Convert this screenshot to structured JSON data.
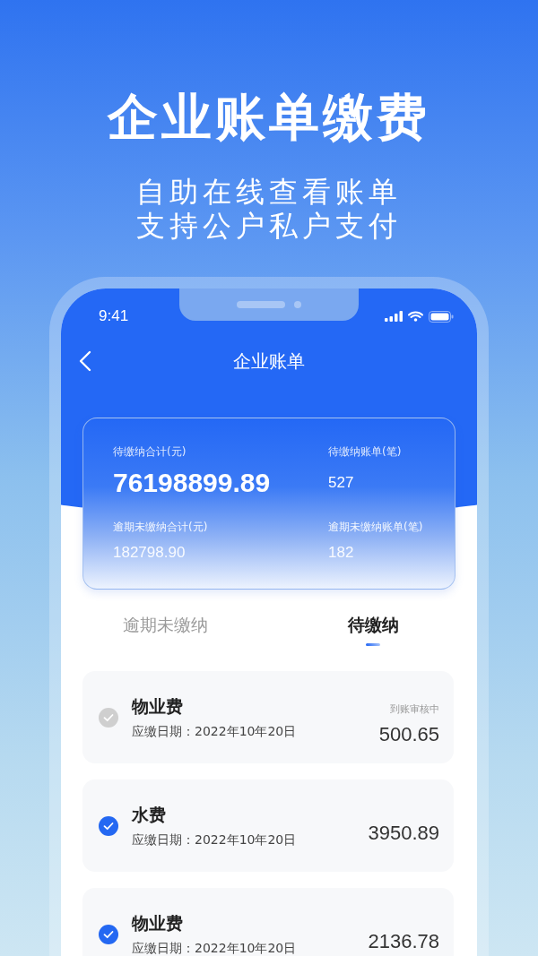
{
  "headline": "企业账单缴费",
  "subtitle_lines": [
    "自助在线查看账单",
    "支持公户私户支付"
  ],
  "status_bar": {
    "time": "9:41"
  },
  "nav": {
    "title": "企业账单"
  },
  "summary": [
    {
      "label": "待缴纳合计(元)",
      "value": "76198899.89",
      "kind": "primary"
    },
    {
      "label": "待缴纳账单(笔)",
      "value": "527",
      "kind": "normal"
    },
    {
      "label": "逾期未缴纳合计(元)",
      "value": "182798.90",
      "kind": "muted"
    },
    {
      "label": "逾期未缴纳账单(笔)",
      "value": "182",
      "kind": "muted"
    }
  ],
  "tabs": [
    {
      "label": "逾期未缴纳",
      "selected": false
    },
    {
      "label": "待缴纳",
      "selected": true
    }
  ],
  "bills": [
    {
      "name": "物业费",
      "due": "应缴日期：2022年10年20日",
      "status": "到账审核中",
      "amount": "500.65",
      "disabled": true
    },
    {
      "name": "水费",
      "due": "应缴日期：2022年10年20日",
      "amount": "3950.89",
      "disabled": false
    },
    {
      "name": "物业费",
      "due": "应缴日期：2022年10年20日",
      "amount": "2136.78",
      "disabled": false
    }
  ]
}
